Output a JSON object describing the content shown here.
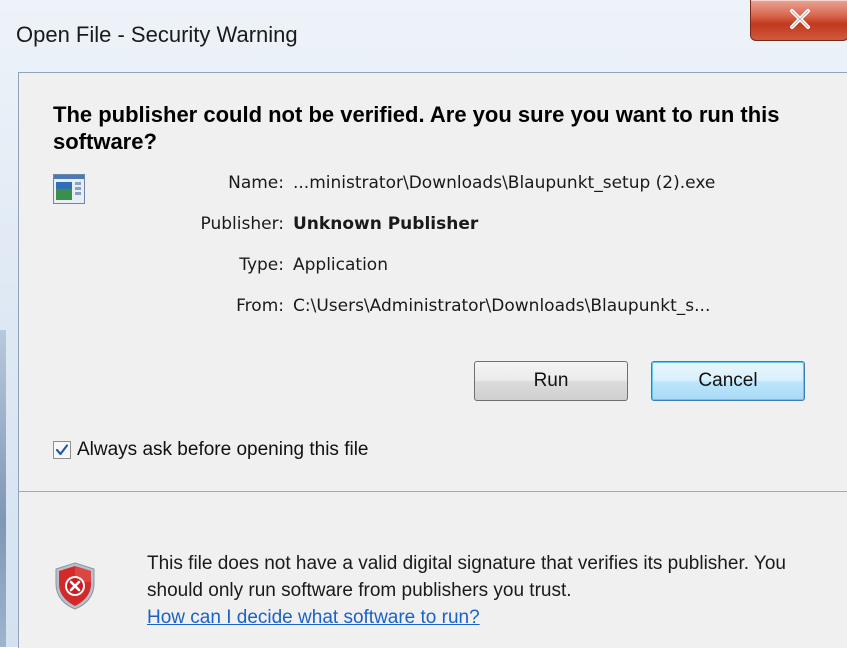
{
  "window": {
    "title": "Open File - Security Warning",
    "close_label": "X"
  },
  "headline": "The publisher could not be verified.  Are you sure you want to run this software?",
  "fields": [
    {
      "label": "Name:",
      "value": "...ministrator\\Downloads\\Blaupunkt_setup (2).exe"
    },
    {
      "label": "Publisher:",
      "value": "Unknown Publisher"
    },
    {
      "label": "Type:",
      "value": "Application"
    },
    {
      "label": "From:",
      "value": "C:\\Users\\Administrator\\Downloads\\Blaupunkt_s..."
    }
  ],
  "buttons": {
    "run_label": "Run",
    "cancel_label": "Cancel"
  },
  "checkbox": {
    "label": "Always ask before opening this file",
    "checked": true
  },
  "footer": {
    "warning_text": "This file does not have a valid digital signature that verifies its publisher.  You should only run software from publishers you trust.",
    "help_link": "How can I decide what software to run?"
  },
  "colors": {
    "link": "#1a62c7",
    "shield_red": "#d3292b",
    "close_red": "#c2391f"
  },
  "icons": {
    "app": "application-icon",
    "shield": "shield-error-icon",
    "check": "checkmark-icon",
    "close": "close-icon"
  }
}
